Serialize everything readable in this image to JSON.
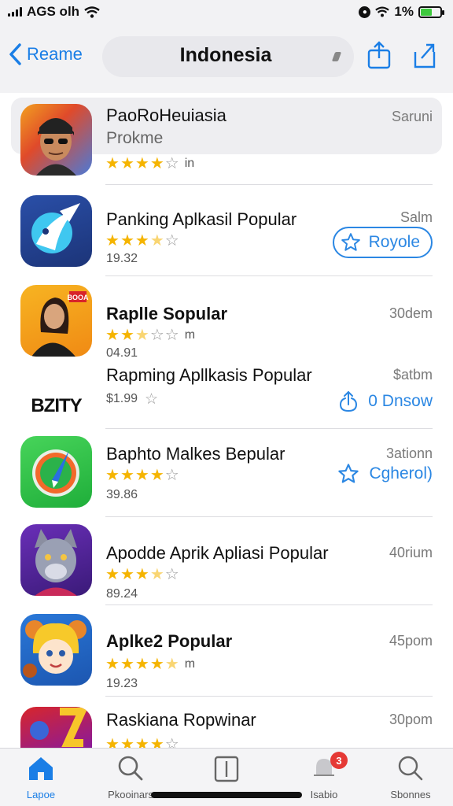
{
  "status_bar": {
    "carrier": "AGS olh",
    "battery_text": "1%",
    "colors": {
      "battery": "#3ec93e"
    }
  },
  "nav": {
    "back_label": "Reame",
    "title": "Indonesia",
    "icons": [
      "chevron-left-icon",
      "share-icon",
      "export-icon"
    ]
  },
  "apps": [
    {
      "title": "PaoRoHeuiasia",
      "subtitle": "Prokme",
      "rating": 4,
      "star_suffix": "in",
      "meta": "",
      "right_label": "Saruni",
      "action": null
    },
    {
      "title": "Panking Aplkasil Popular",
      "subtitle": "",
      "rating": 3.5,
      "star_suffix": "",
      "meta": "19.32",
      "right_label": "Salm",
      "action": {
        "style": "pill",
        "label": "Royole",
        "icon": "star-outline-icon"
      }
    },
    {
      "title": "Raplle Sopular",
      "subtitle": "",
      "rating": 2.5,
      "star_suffix": "m",
      "meta": "04.91",
      "right_label": "30dem",
      "action": null
    },
    {
      "title": "Rapming Apllkasis Popular",
      "subtitle": "",
      "rating": 0,
      "star_suffix": "",
      "meta": "$1.99",
      "right_label": "$atbm",
      "action": {
        "style": "plain",
        "label": "0 Dnsow",
        "icon": "download-icon"
      }
    },
    {
      "title": "Baphto Malkes Bepular",
      "subtitle": "",
      "rating": 4,
      "star_suffix": "",
      "meta": "39.86",
      "right_label": "3ationn",
      "action": {
        "style": "plain",
        "label": "Cgherol)",
        "icon": "star-outline-icon"
      }
    },
    {
      "title": "Apodde Aprik Apliasi Popular",
      "subtitle": "",
      "rating": 3.5,
      "star_suffix": "",
      "meta": "89.24",
      "right_label": "40rium",
      "action": null
    },
    {
      "title": "Aplke2 Popular",
      "subtitle": "",
      "rating": 4.5,
      "star_suffix": "m",
      "meta": "19.23",
      "right_label": "45pom",
      "action": null
    },
    {
      "title": "Raskiana Ropwinar",
      "subtitle": "",
      "rating": 4,
      "star_suffix": "",
      "meta": "",
      "right_label": "30pom",
      "action": null
    }
  ],
  "app4_logo_text": "BZITY",
  "app3_badge_text": "BOOA",
  "tabs": [
    {
      "label": "Lapoe",
      "icon": "home-icon",
      "active": true
    },
    {
      "label": "Pkooinars",
      "icon": "search-icon",
      "active": false
    },
    {
      "label": "",
      "icon": "library-icon",
      "active": false
    },
    {
      "label": "Isabio",
      "icon": "bell-icon",
      "active": false,
      "badge": "3"
    },
    {
      "label": "Sbonnes",
      "icon": "search-icon",
      "active": false
    }
  ],
  "colors": {
    "accent": "#1a7ee6",
    "star": "#f5b400",
    "badge": "#e53935"
  }
}
